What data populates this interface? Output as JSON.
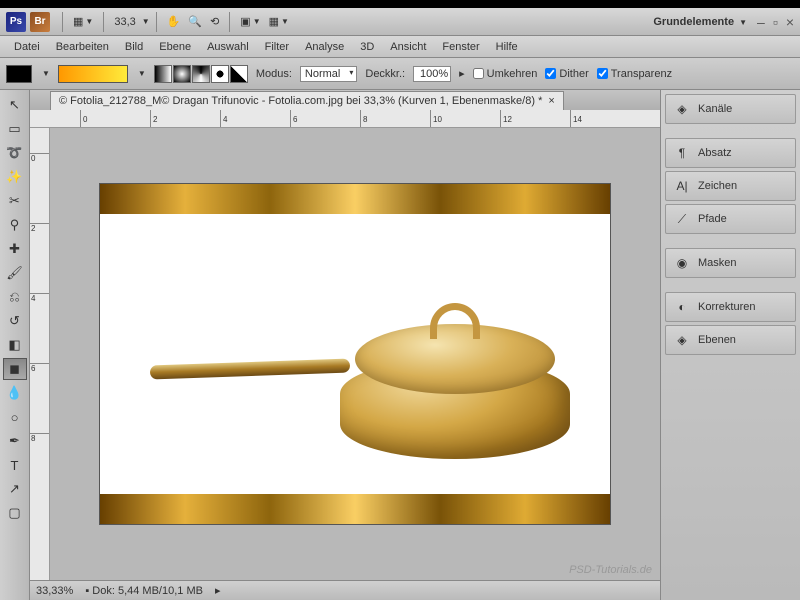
{
  "topbar": {
    "zoom_value": "33,3",
    "workspace": "Grundelemente"
  },
  "menu": {
    "file": "Datei",
    "edit": "Bearbeiten",
    "image": "Bild",
    "layer": "Ebene",
    "select": "Auswahl",
    "filter": "Filter",
    "analyze": "Analyse",
    "threeD": "3D",
    "view": "Ansicht",
    "window": "Fenster",
    "help": "Hilfe"
  },
  "options": {
    "mode_label": "Modus:",
    "mode_value": "Normal",
    "opacity_label": "Deckkr.:",
    "opacity_value": "100%",
    "reverse": "Umkehren",
    "dither": "Dither",
    "transparency": "Transparenz"
  },
  "document": {
    "tab_title": "© Fotolia_212788_M© Dragan Trifunovic - Fotolia.com.jpg bei 33,3% (Kurven 1, Ebenenmaske/8) *"
  },
  "ruler_h": [
    "0",
    "2",
    "4",
    "6",
    "8",
    "10",
    "12",
    "14"
  ],
  "ruler_v": [
    "0",
    "2",
    "4",
    "6",
    "8"
  ],
  "status": {
    "zoom": "33,33%",
    "doc_info": "Dok: 5,44 MB/10,1 MB"
  },
  "panels": {
    "channels": "Kanäle",
    "paragraph": "Absatz",
    "character": "Zeichen",
    "paths": "Pfade",
    "masks": "Masken",
    "adjustments": "Korrekturen",
    "layers": "Ebenen"
  },
  "watermark": "PSD-Tutorials.de"
}
